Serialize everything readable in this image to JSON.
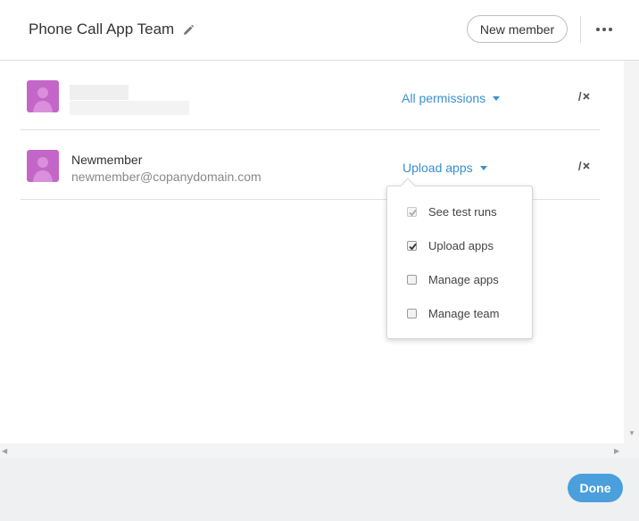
{
  "header": {
    "team_title": "Phone Call App Team",
    "edit_icon": "pencil-icon",
    "new_member_label": "New member",
    "more_icon": "more-horizontal-icon"
  },
  "members": [
    {
      "name": "",
      "email": "",
      "redacted": true,
      "permission_label": "All permissions",
      "avatar_icon": "default-avatar-icon",
      "remove_icon": "remove-member-icon"
    },
    {
      "name": "Newmember",
      "email": "newmember@copanydomain.com",
      "redacted": false,
      "permission_label": "Upload apps",
      "avatar_icon": "default-avatar-icon",
      "remove_icon": "remove-member-icon"
    }
  ],
  "permissions_dropdown": {
    "options": [
      {
        "label": "See test runs",
        "checked": true,
        "disabled": true
      },
      {
        "label": "Upload apps",
        "checked": true,
        "disabled": false
      },
      {
        "label": "Manage apps",
        "checked": false,
        "disabled": false
      },
      {
        "label": "Manage team",
        "checked": false,
        "disabled": false
      }
    ]
  },
  "footer": {
    "done_label": "Done"
  },
  "colors": {
    "accent": "#3a8fd0",
    "done_button": "#4a9fdc",
    "avatar": "#c466c8"
  }
}
